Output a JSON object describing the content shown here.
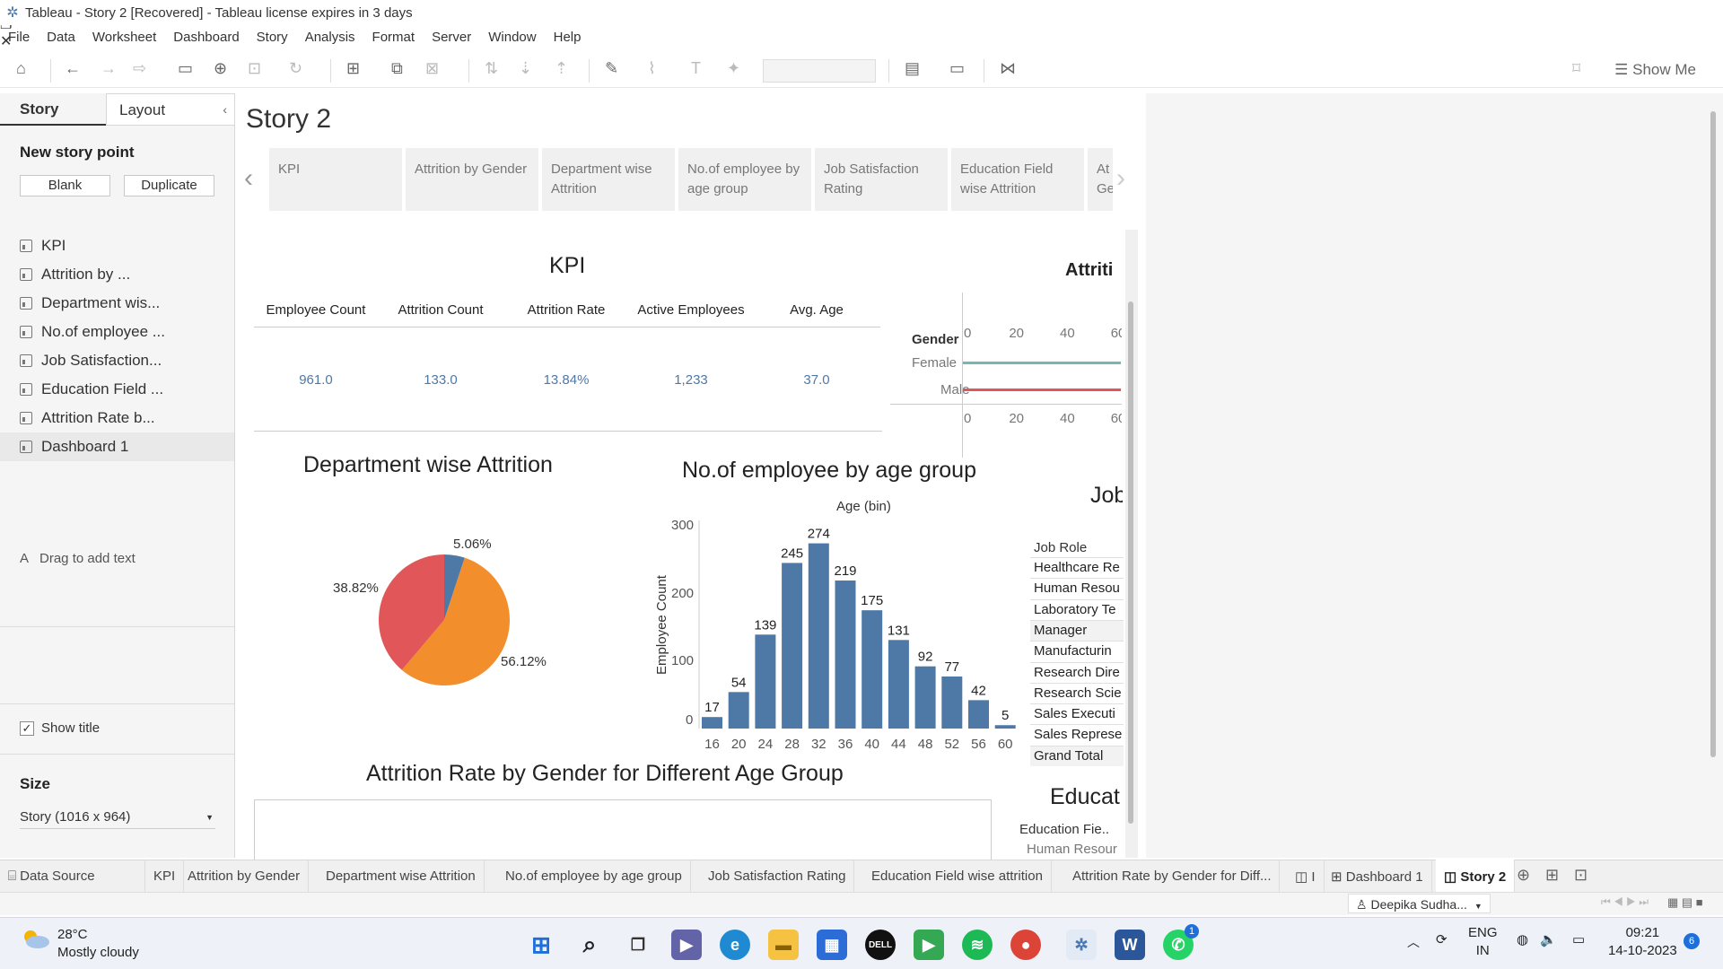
{
  "window": {
    "title": "Tableau - Story 2 [Recovered] - Tableau license expires in 3 days",
    "controls": {
      "minimize": "–",
      "maximize": "❐",
      "close": "✕"
    }
  },
  "menu": [
    "File",
    "Data",
    "Worksheet",
    "Dashboard",
    "Story",
    "Analysis",
    "Format",
    "Server",
    "Window",
    "Help"
  ],
  "toolbar": {
    "show_me": "Show Me"
  },
  "left_pane": {
    "tab_story": "Story",
    "tab_layout": "Layout",
    "new_story_point": "New story point",
    "blank": "Blank",
    "duplicate": "Duplicate",
    "items": [
      "KPI",
      "Attrition by ...",
      "Department wis...",
      "No.of employee ...",
      "Job Satisfaction...",
      "Education Field ...",
      "Attrition Rate b...",
      "Dashboard 1"
    ],
    "drag_text": "Drag to add text",
    "text_icon": "A",
    "show_title": "Show title",
    "size_label": "Size",
    "size_value": "Story (1016 x 964)"
  },
  "story": {
    "title": "Story 2",
    "points": [
      {
        "label": "KPI"
      },
      {
        "label": "Attrition by Gender"
      },
      {
        "label": "Department wise Attrition"
      },
      {
        "label": "No.of employee by age group"
      },
      {
        "label": "Job Satisfaction Rating"
      },
      {
        "label": "Education Field wise Attrition"
      },
      {
        "label": "At Ge"
      }
    ]
  },
  "kpi": {
    "title": "KPI",
    "headers": [
      "Employee Count",
      "Attrition Count",
      "Attrition Rate",
      "Active Employees",
      "Avg. Age"
    ],
    "values": [
      "961.0",
      "133.0",
      "13.84%",
      "1,233",
      "37.0"
    ]
  },
  "attrition_gender": {
    "title_fragment": "Attriti",
    "gender_label": "Gender",
    "rows": [
      "Female",
      "Male"
    ],
    "axis_ticks": [
      "0",
      "20",
      "40",
      "60"
    ],
    "colors": {
      "Female": "#76b7b2",
      "Male": "#e15759"
    }
  },
  "department": {
    "title": "Department wise Attrition",
    "labels": [
      "5.06%",
      "38.82%",
      "56.12%"
    ]
  },
  "age_group": {
    "title": "No.of employee by age group",
    "xlabel": "Age (bin)",
    "ylabel": "Employee Count",
    "y_ticks": [
      "300",
      "200",
      "100",
      "0"
    ]
  },
  "job_role": {
    "title_fragment": "Job",
    "header": "Job Role",
    "rows": [
      "Healthcare Re",
      "Human Resou",
      "Laboratory Te",
      "Manager",
      "Manufacturin",
      "Research Dire",
      "Research Scie",
      "Sales Executi",
      "Sales Represe",
      "Grand Total"
    ]
  },
  "education": {
    "title_fragment": "Educat",
    "header": "Education Fie..",
    "row": "Human Resour"
  },
  "bottom_title": "Attrition Rate by Gender for Different Age Group",
  "chart_data": [
    {
      "type": "pie",
      "title": "Department wise Attrition",
      "slices": [
        {
          "label": "5.06%",
          "value": 5.06,
          "color": "#4e79a7"
        },
        {
          "label": "56.12%",
          "value": 56.12,
          "color": "#f28e2b"
        },
        {
          "label": "38.82%",
          "value": 38.82,
          "color": "#e15759"
        }
      ]
    },
    {
      "type": "bar",
      "title": "No.of employee by age group",
      "xlabel": "Age (bin)",
      "ylabel": "Employee Count",
      "categories": [
        "16",
        "20",
        "24",
        "28",
        "32",
        "36",
        "40",
        "44",
        "48",
        "52",
        "56",
        "60"
      ],
      "values": [
        17,
        54,
        139,
        245,
        274,
        219,
        175,
        131,
        92,
        77,
        42,
        5
      ],
      "ylim": [
        0,
        300
      ],
      "color": "#4e79a7"
    }
  ],
  "sheet_tabs": [
    {
      "label": "Data Source"
    },
    {
      "label": "KPI"
    },
    {
      "label": "Attrition by Gender"
    },
    {
      "label": "Department wise Attrition"
    },
    {
      "label": "No.of employee by age group"
    },
    {
      "label": "Job Satisfaction Rating"
    },
    {
      "label": "Education Field wise attrition"
    },
    {
      "label": "Attrition Rate by Gender for Diff..."
    },
    {
      "label": "I"
    },
    {
      "label": "Dashboard 1"
    },
    {
      "label": "Story 2"
    }
  ],
  "status": {
    "user": "Deepika Sudha..."
  },
  "taskbar": {
    "temp": "28°C",
    "weather": "Mostly cloudy",
    "lang1": "ENG",
    "lang2": "IN",
    "time": "09:21",
    "date": "14-10-2023",
    "notif": "6",
    "whatsapp_badge": "1"
  }
}
